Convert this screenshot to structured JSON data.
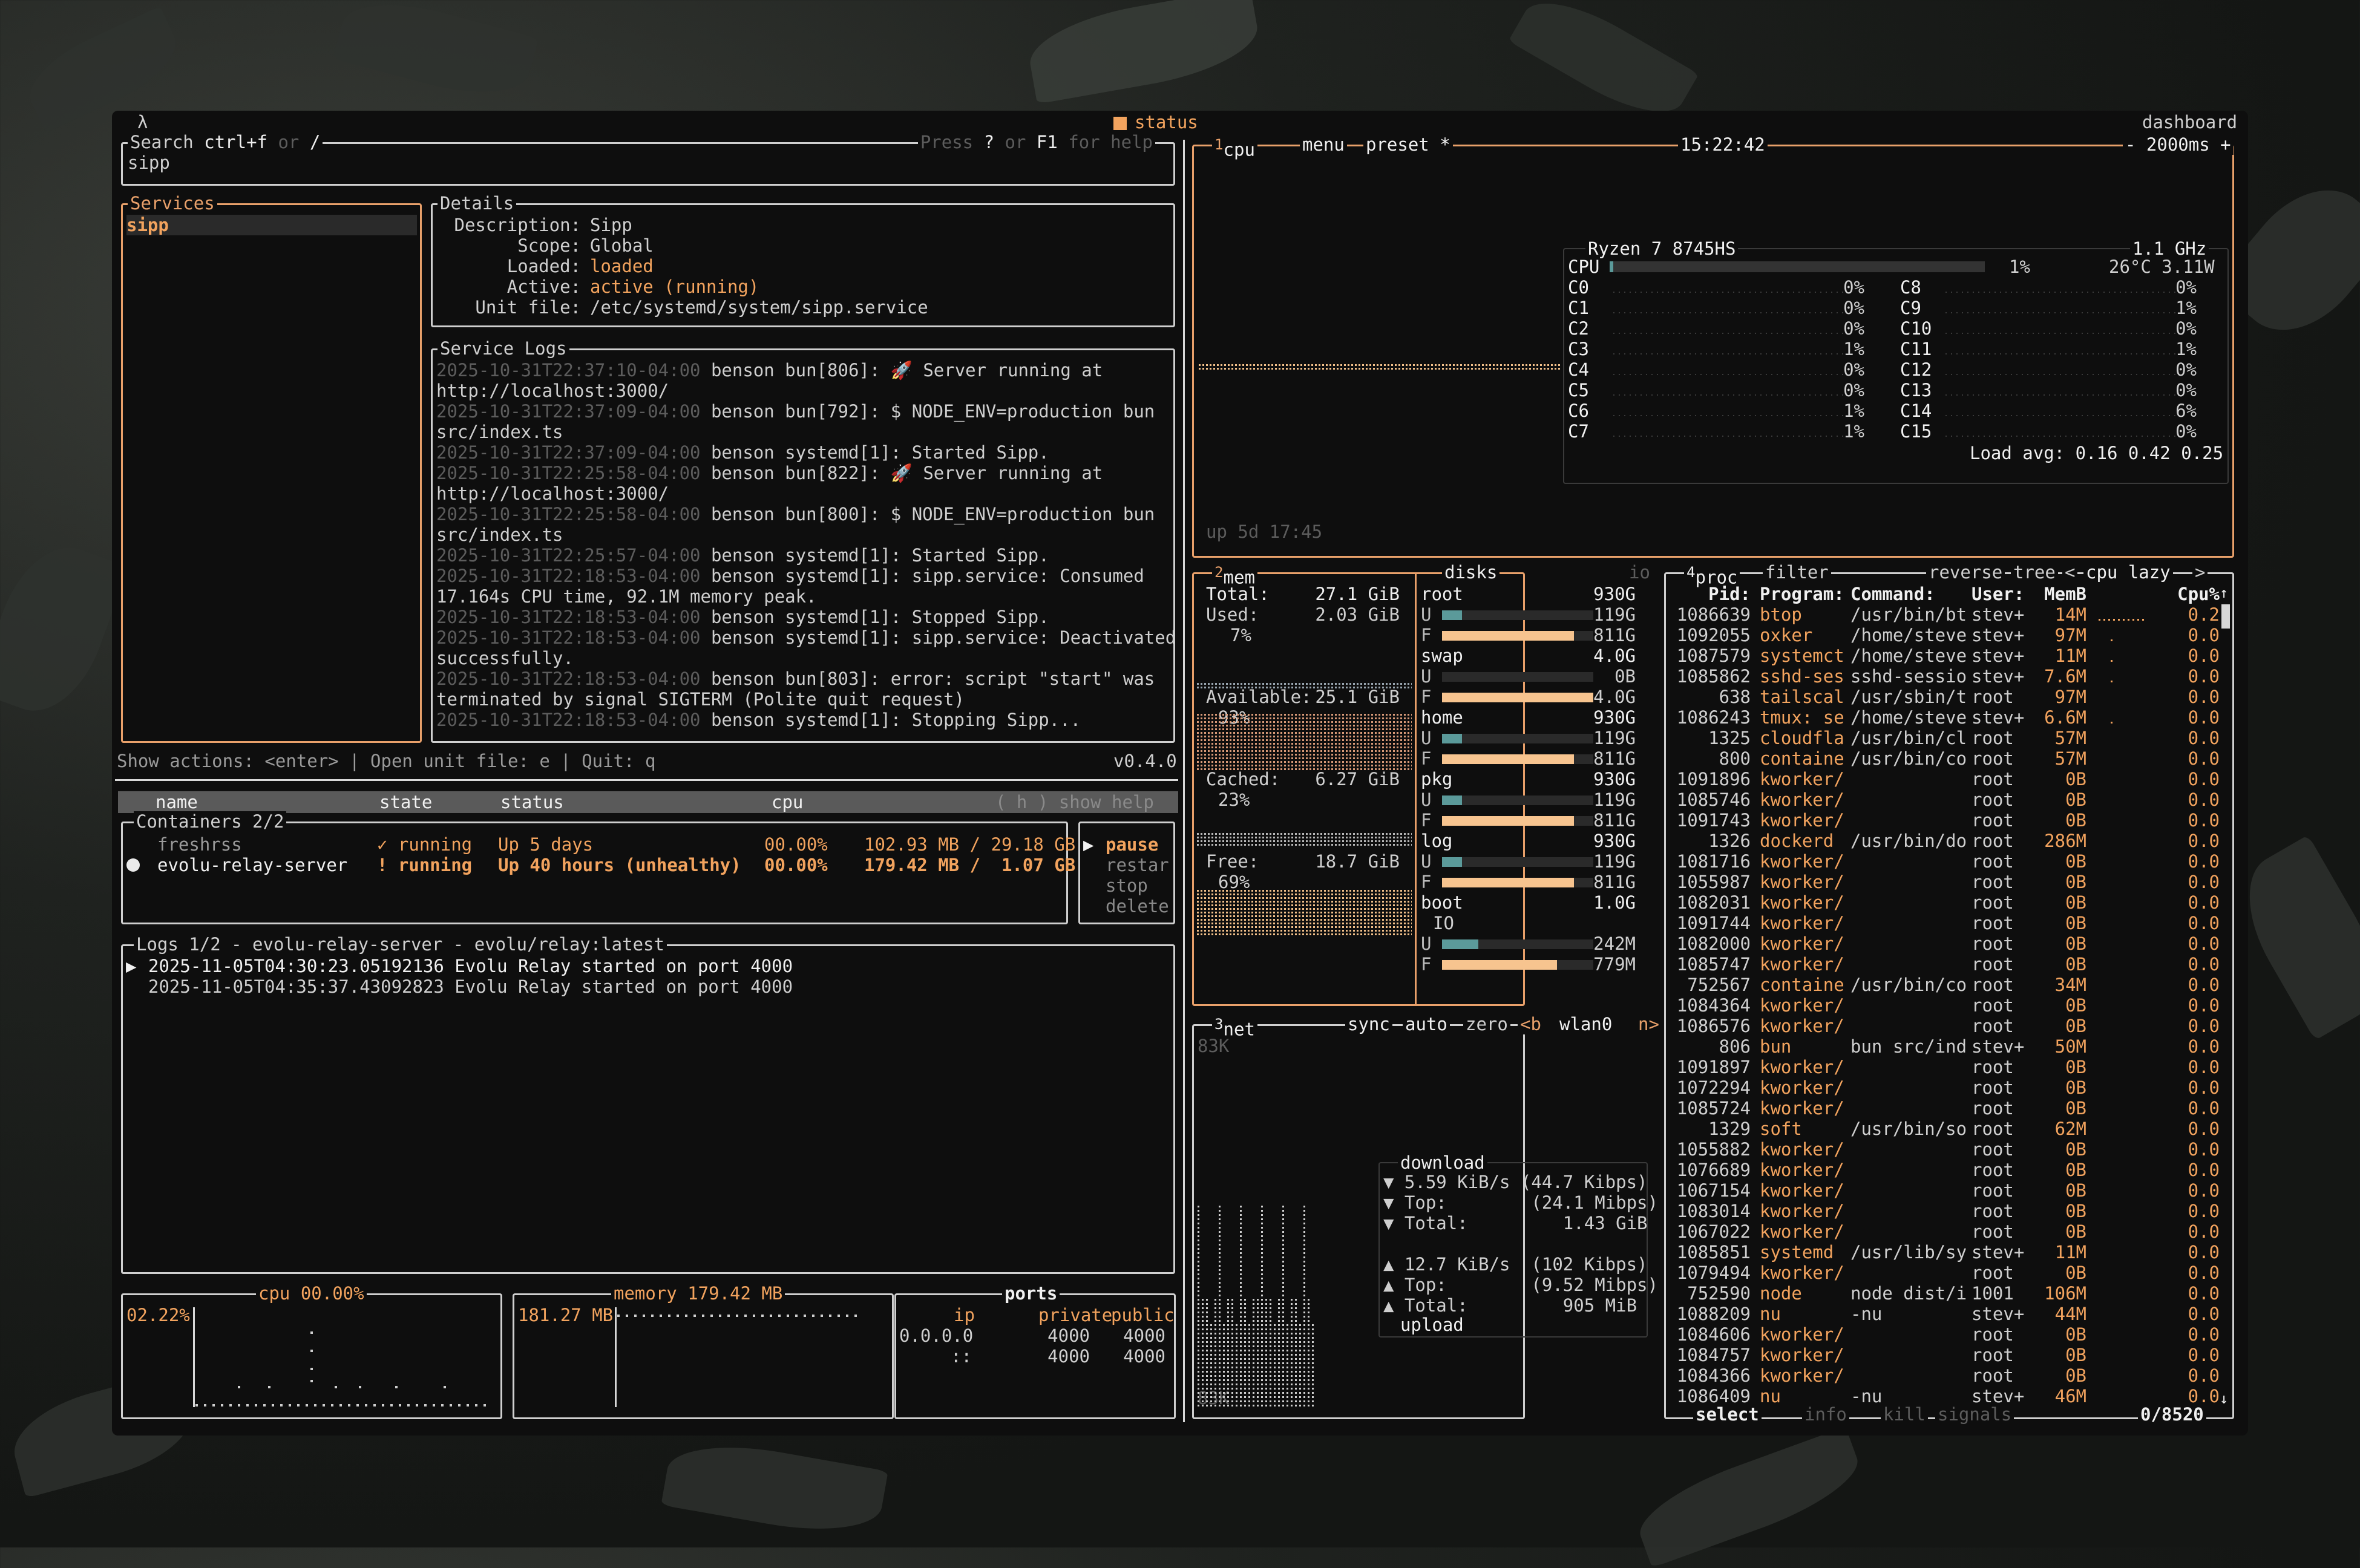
{
  "top": {
    "lambda": "λ",
    "status": "status",
    "dashboard": "dashboard"
  },
  "search": {
    "label": "Search",
    "key1": "ctrl+f",
    "or": "or",
    "key2": "/",
    "help_press": "Press",
    "help_key1": "?",
    "help_or": "or",
    "help_key2": "F1",
    "help_for": "for help",
    "value": "sipp"
  },
  "services": {
    "title": "Services",
    "items": [
      "sipp"
    ]
  },
  "details": {
    "title": "Details",
    "rows": [
      [
        "Description:",
        "Sipp"
      ],
      [
        "Scope:",
        "Global"
      ],
      [
        "Loaded:",
        "loaded"
      ],
      [
        "Active:",
        "active (running)"
      ],
      [
        "Unit file:",
        "/etc/systemd/system/sipp.service"
      ]
    ]
  },
  "service_logs": {
    "title": "Service Logs",
    "lines": [
      [
        "2025-10-31T22:37:10-04:00",
        "benson bun[806]: 🚀 Server running at"
      ],
      [
        "",
        "http://localhost:3000/"
      ],
      [
        "2025-10-31T22:37:09-04:00",
        "benson bun[792]: $ NODE_ENV=production bun"
      ],
      [
        "",
        "src/index.ts"
      ],
      [
        "2025-10-31T22:37:09-04:00",
        "benson systemd[1]: Started Sipp."
      ],
      [
        "2025-10-31T22:25:58-04:00",
        "benson bun[822]: 🚀 Server running at"
      ],
      [
        "",
        "http://localhost:3000/"
      ],
      [
        "2025-10-31T22:25:58-04:00",
        "benson bun[800]: $ NODE_ENV=production bun"
      ],
      [
        "",
        "src/index.ts"
      ],
      [
        "2025-10-31T22:25:57-04:00",
        "benson systemd[1]: Started Sipp."
      ],
      [
        "2025-10-31T22:18:53-04:00",
        "benson systemd[1]: sipp.service: Consumed"
      ],
      [
        "",
        "17.164s CPU time, 92.1M memory peak."
      ],
      [
        "2025-10-31T22:18:53-04:00",
        "benson systemd[1]: Stopped Sipp."
      ],
      [
        "2025-10-31T22:18:53-04:00",
        "benson systemd[1]: sipp.service: Deactivated"
      ],
      [
        "",
        "successfully."
      ],
      [
        "2025-10-31T22:18:53-04:00",
        "benson bun[803]: error: script \"start\" was"
      ],
      [
        "",
        "terminated by signal SIGTERM (Polite quit request)"
      ],
      [
        "2025-10-31T22:18:53-04:00",
        "benson systemd[1]: Stopping Sipp..."
      ]
    ]
  },
  "footer": {
    "actions": "Show actions: <enter> | Open unit file: e | Quit: q",
    "version": "v0.4.0"
  },
  "containers": {
    "header_name": "name",
    "header_state": "state",
    "header_status": "status",
    "header_cpu": "cpu",
    "header_help": "( h ) show help",
    "title": "Containers 2/2",
    "rows": [
      {
        "name": "freshrss",
        "state": "✓ running",
        "status": "Up 5 days",
        "cpu": "00.00%",
        "mem": "102.93 MB / 29.18 GB"
      },
      {
        "name": "evolu-relay-server",
        "state": "! running",
        "status": "Up 40 hours (unhealthy)",
        "cpu": "00.00%",
        "mem": "179.42 MB /  1.07 GB"
      }
    ],
    "actions": [
      "pause",
      "restar",
      "stop",
      "delete"
    ],
    "action_marker": "▶"
  },
  "clogs": {
    "title": "Logs 1/2 - evolu-relay-server - evolu/relay:latest",
    "lines": [
      "2025-11-05T04:30:23.05192136 Evolu Relay started on port 4000",
      "2025-11-05T04:35:37.43092823 Evolu Relay started on port 4000"
    ],
    "marker": "▶"
  },
  "cpu_panel": {
    "title": "cpu 00.00%",
    "value": "02.22%"
  },
  "mem_panel": {
    "title": "memory 179.42 MB",
    "value": "181.27 MB"
  },
  "ports": {
    "title": "ports",
    "headers": [
      "ip",
      "private",
      "public"
    ],
    "rows": [
      [
        "0.0.0.0",
        "4000",
        "4000"
      ],
      [
        "::",
        "4000",
        "4000"
      ]
    ]
  },
  "btop_cpu": {
    "num": "1",
    "tab_cpu": "cpu",
    "tab_menu": "menu",
    "tab_preset": "preset *",
    "time": "15:22:42",
    "interval": "- 2000ms +",
    "model": "Ryzen 7 8745HS",
    "freq": "1.1 GHz",
    "total_label": "CPU",
    "total_pct": "1%",
    "temp": "26°C 3.11W",
    "pct_total": 1,
    "cores_left": [
      [
        "C0",
        "0%"
      ],
      [
        "C1",
        "0%"
      ],
      [
        "C2",
        "0%"
      ],
      [
        "C3",
        "1%"
      ],
      [
        "C4",
        "0%"
      ],
      [
        "C5",
        "0%"
      ],
      [
        "C6",
        "1%"
      ],
      [
        "C7",
        "1%"
      ]
    ],
    "cores_right": [
      [
        "C8",
        "0%"
      ],
      [
        "C9",
        "1%"
      ],
      [
        "C10",
        "0%"
      ],
      [
        "C11",
        "1%"
      ],
      [
        "C12",
        "0%"
      ],
      [
        "C13",
        "0%"
      ],
      [
        "C14",
        "6%"
      ],
      [
        "C15",
        "0%"
      ]
    ],
    "load": "Load avg: 0.16 0.42 0.25",
    "uptime": "up 5d 17:45"
  },
  "btop_mem": {
    "num": "2",
    "title": "mem",
    "disks": "disks",
    "io": "io",
    "total_l": "Total:",
    "total_v": "27.1 GiB",
    "used_l": "Used:",
    "used_v": "2.03 GiB",
    "used_p": "7%",
    "avail_l": "Available:",
    "avail_v": "25.1 GiB",
    "avail_p": "93%",
    "cached_l": "Cached:",
    "cached_v": "6.27 GiB",
    "cached_p": "23%",
    "free_l": "Free:",
    "free_v": "18.7 GiB",
    "free_p": "69%",
    "disk_list": [
      {
        "name": "root",
        "size": "930G",
        "u": "119G",
        "f": "811G",
        "uf": 0.13,
        "ff": 0.87
      },
      {
        "name": "swap",
        "size": "4.0G",
        "u": "0B",
        "f": "4.0G",
        "uf": 0,
        "ff": 1
      },
      {
        "name": "home",
        "size": "930G",
        "u": "119G",
        "f": "811G",
        "uf": 0.13,
        "ff": 0.87
      },
      {
        "name": "pkg",
        "size": "930G",
        "u": "119G",
        "f": "811G",
        "uf": 0.13,
        "ff": 0.87
      },
      {
        "name": "log",
        "size": "930G",
        "u": "119G",
        "f": "811G",
        "uf": 0.13,
        "ff": 0.87
      },
      {
        "name": "boot",
        "size": "1.0G",
        "io": "IO",
        "u": "242M",
        "f": "779M",
        "uf": 0.24,
        "ff": 0.76
      }
    ]
  },
  "btop_net": {
    "num": "3",
    "title": "net",
    "sync": "sync",
    "auto": "auto",
    "zero": "zero",
    "prev": "<b",
    "iface": "wlan0",
    "next": "n>",
    "top_scale": "83K",
    "bot_scale": "83K",
    "download": "download",
    "dl_rate": "▼ 5.59 KiB/s (44.7 Kibps)",
    "dl_top": "▼ Top:        (24.1 Mibps)",
    "dl_total": "▼ Total:         1.43 GiB",
    "ul_rate": "▲ 12.7 KiB/s  (102 Kibps)",
    "ul_top": "▲ Top:        (9.52 Mibps)",
    "ul_total": "▲ Total:         905 MiB",
    "upload": "upload"
  },
  "btop_proc": {
    "num": "4",
    "title": "proc",
    "filter": "filter",
    "reverse": "reverse",
    "tree": "tree",
    "sort_prev": "<",
    "sort": "cpu lazy",
    "sort_next": ">",
    "headers": [
      "Pid:",
      "Program:",
      "Command:",
      "User:",
      "MemB",
      "Cpu%"
    ],
    "rows": [
      [
        "1086639",
        "btop",
        "/usr/bin/bt",
        "stev+",
        "14M",
        "0.2"
      ],
      [
        "1092055",
        "oxker",
        "/home/steve",
        "stev+",
        "97M",
        "0.0"
      ],
      [
        "1087579",
        "systemct",
        "/home/steve",
        "stev+",
        "11M",
        "0.0"
      ],
      [
        "1085862",
        "sshd-ses",
        "sshd-sessio",
        "stev+",
        "7.6M",
        "0.0"
      ],
      [
        "638",
        "tailscal",
        "/usr/sbin/t",
        "root",
        "97M",
        "0.0"
      ],
      [
        "1086243",
        "tmux: se",
        "/home/steve",
        "stev+",
        "6.6M",
        "0.0"
      ],
      [
        "1325",
        "cloudfla",
        "/usr/bin/cl",
        "root",
        "57M",
        "0.0"
      ],
      [
        "800",
        "containe",
        "/usr/bin/co",
        "root",
        "57M",
        "0.0"
      ],
      [
        "1091896",
        "kworker/",
        "",
        "root",
        "0B",
        "0.0"
      ],
      [
        "1085746",
        "kworker/",
        "",
        "root",
        "0B",
        "0.0"
      ],
      [
        "1091743",
        "kworker/",
        "",
        "root",
        "0B",
        "0.0"
      ],
      [
        "1326",
        "dockerd",
        "/usr/bin/do",
        "root",
        "286M",
        "0.0"
      ],
      [
        "1081716",
        "kworker/",
        "",
        "root",
        "0B",
        "0.0"
      ],
      [
        "1055987",
        "kworker/",
        "",
        "root",
        "0B",
        "0.0"
      ],
      [
        "1082031",
        "kworker/",
        "",
        "root",
        "0B",
        "0.0"
      ],
      [
        "1091744",
        "kworker/",
        "",
        "root",
        "0B",
        "0.0"
      ],
      [
        "1082000",
        "kworker/",
        "",
        "root",
        "0B",
        "0.0"
      ],
      [
        "1085747",
        "kworker/",
        "",
        "root",
        "0B",
        "0.0"
      ],
      [
        "752567",
        "containe",
        "/usr/bin/co",
        "root",
        "34M",
        "0.0"
      ],
      [
        "1084364",
        "kworker/",
        "",
        "root",
        "0B",
        "0.0"
      ],
      [
        "1086576",
        "kworker/",
        "",
        "root",
        "0B",
        "0.0"
      ],
      [
        "806",
        "bun",
        "bun src/ind",
        "stev+",
        "50M",
        "0.0"
      ],
      [
        "1091897",
        "kworker/",
        "",
        "root",
        "0B",
        "0.0"
      ],
      [
        "1072294",
        "kworker/",
        "",
        "root",
        "0B",
        "0.0"
      ],
      [
        "1085724",
        "kworker/",
        "",
        "root",
        "0B",
        "0.0"
      ],
      [
        "1329",
        "soft",
        "/usr/bin/so",
        "root",
        "62M",
        "0.0"
      ],
      [
        "1055882",
        "kworker/",
        "",
        "root",
        "0B",
        "0.0"
      ],
      [
        "1076689",
        "kworker/",
        "",
        "root",
        "0B",
        "0.0"
      ],
      [
        "1067154",
        "kworker/",
        "",
        "root",
        "0B",
        "0.0"
      ],
      [
        "1083014",
        "kworker/",
        "",
        "root",
        "0B",
        "0.0"
      ],
      [
        "1067022",
        "kworker/",
        "",
        "root",
        "0B",
        "0.0"
      ],
      [
        "1085851",
        "systemd",
        "/usr/lib/sy",
        "stev+",
        "11M",
        "0.0"
      ],
      [
        "1079494",
        "kworker/",
        "",
        "root",
        "0B",
        "0.0"
      ],
      [
        "752590",
        "node",
        "node dist/i",
        "1001",
        "106M",
        "0.0"
      ],
      [
        "1088209",
        "nu",
        "-nu",
        "stev+",
        "44M",
        "0.0"
      ],
      [
        "1084606",
        "kworker/",
        "",
        "root",
        "0B",
        "0.0"
      ],
      [
        "1084757",
        "kworker/",
        "",
        "root",
        "0B",
        "0.0"
      ],
      [
        "1084366",
        "kworker/",
        "",
        "root",
        "0B",
        "0.0"
      ],
      [
        "1086409",
        "nu",
        "-nu",
        "stev+",
        "46M",
        "0.0"
      ]
    ],
    "select": "select",
    "info": "info",
    "kill": "kill",
    "signals": "signals",
    "count": "0/8520",
    "arrow_up": "↑",
    "arrow_down": "↓"
  },
  "colors": {
    "accent": "#f2a35e",
    "frame": "#e8a06a",
    "dim": "#5c5c5c",
    "bg": "#0e0e0e",
    "bar_used": "#5b9a9a",
    "bar_free": "#f7c48f"
  }
}
